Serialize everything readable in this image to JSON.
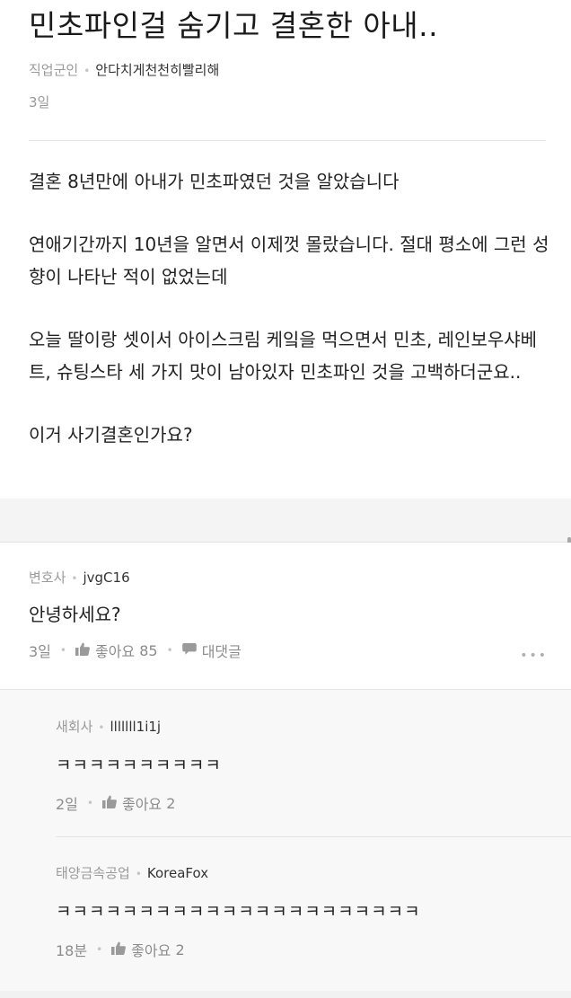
{
  "post": {
    "title": "민초파인걸 숨기고 결혼한 아내..",
    "author_job": "직업군인",
    "author_nick": "안다치게천천히빨리해",
    "time": "3일",
    "body": [
      "결혼 8년만에 아내가 민초파였던 것을 알았습니다",
      "연애기간까지 10년을 알면서 이제껏 몰랐습니다. 절대 평소에 그런 성향이 나타난 적이 없었는데",
      "오늘 딸이랑 셋이서 아이스크림 케잌을 먹으면서 민초, 레인보우샤베트, 슈팅스타 세 가지 맛이 남아있자 민초파인 것을 고백하더군요..",
      "이거 사기결혼인가요?"
    ]
  },
  "comment": {
    "author_job": "변호사",
    "author_nick": "jvgC16",
    "text": "안녕하세요?",
    "time": "3일",
    "like_label": "좋아요",
    "like_count": "85",
    "reply_label": "대댓글",
    "more_label": "•••"
  },
  "replies": [
    {
      "author_job": "새회사",
      "author_nick": "lllllll1i1j",
      "text": "ㅋㅋㅋㅋㅋㅋㅋㅋㅋㅋ",
      "time": "2일",
      "like_label": "좋아요",
      "like_count": "2"
    },
    {
      "author_job": "태양금속공업",
      "author_nick": "KoreaFox",
      "text": "ㅋㅋㅋㅋㅋㅋㅋㅋㅋㅋㅋㅋㅋㅋㅋㅋㅋㅋㅋㅋㅋㅋ",
      "time": "18분",
      "like_label": "좋아요",
      "like_count": "2"
    }
  ],
  "icons": {
    "like": "thumbs-up-icon",
    "reply": "speech-bubble-icon",
    "more": "more-dots-icon"
  },
  "colors": {
    "separator": "#f4f4f4",
    "meta_gray": "#9a9a9a",
    "reply_bg": "#f8f8f8"
  }
}
